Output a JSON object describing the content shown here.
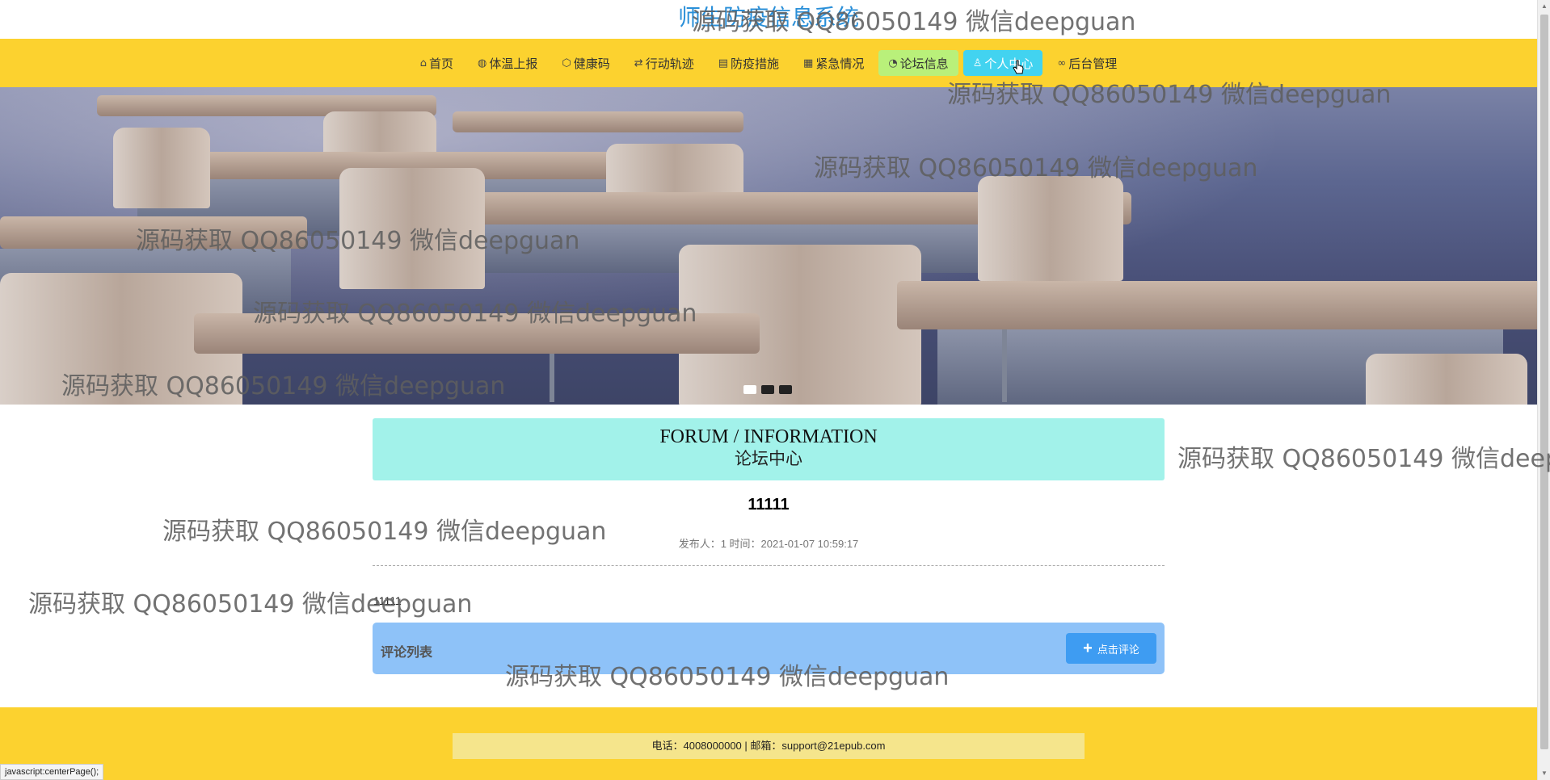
{
  "site": {
    "title": "师生防疫信息系统"
  },
  "nav": {
    "items": [
      {
        "label": "首页",
        "icon": "home-icon",
        "glyph": "⌂"
      },
      {
        "label": "体温上报",
        "icon": "globe-icon",
        "glyph": "◍"
      },
      {
        "label": "健康码",
        "icon": "cube-icon",
        "glyph": "⬡"
      },
      {
        "label": "行动轨迹",
        "icon": "sliders-icon",
        "glyph": "⇄"
      },
      {
        "label": "防疫措施",
        "icon": "calendar-icon",
        "glyph": "▤"
      },
      {
        "label": "紧急情况",
        "icon": "grid-icon",
        "glyph": "▦"
      },
      {
        "label": "论坛信息",
        "icon": "chat-icon",
        "glyph": "◔"
      },
      {
        "label": "个人中心",
        "icon": "user-icon",
        "glyph": "♙"
      },
      {
        "label": "后台管理",
        "icon": "link-icon",
        "glyph": "∞"
      }
    ]
  },
  "banner": {
    "slides": 3,
    "active_slide": 1
  },
  "forum": {
    "header_en": "FORUM / INFORMATION",
    "header_cn": "论坛中心"
  },
  "post": {
    "title": "11111",
    "meta": "发布人：1 时间：2021-01-07 10:59:17",
    "content": "11111"
  },
  "comments": {
    "label": "评论列表",
    "button_label": "点击评论"
  },
  "footer": {
    "contact": "电话：4008000000 | 邮箱：support@21epub.com"
  },
  "status_bar": {
    "url": "javascript:centerPage();"
  },
  "watermark": {
    "text": "源码获取 QQ86050149 微信deepguan",
    "text_cut": "源码获取 QQ86050149 微信deep"
  },
  "colors": {
    "nav_bg": "#fcd22f",
    "forum_header_bg": "#a2f2ea",
    "comment_bar_bg": "#8ec2f8",
    "title_color": "#2a8fd8"
  }
}
